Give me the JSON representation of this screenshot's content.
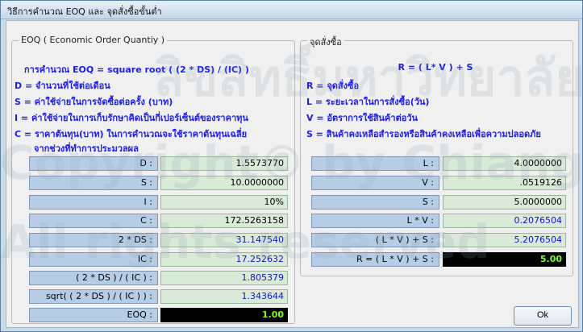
{
  "window": {
    "title": "วิธีการคำนวณ EOQ และ จุดสั่งซื้อขั้นต่ำ"
  },
  "eoq": {
    "group_title": "EOQ ( Economic Order Quantiy )",
    "formula": "การคำนวณ EOQ = square root ( (2 * DS) / (IC) )",
    "defs": [
      "D = จำนวนที่ใช้ต่อเดือน",
      "S = ค่าใช้จ่ายในการจัดซื้อต่อครั้ง (บาท)",
      "I = ค่าใช้จ่ายในการเก็บรักษาคิดเป็นกี่เปอร์เซ็นต์ของราคาทุน",
      "C = ราคาต้นทุน(บาท) ในการคำนวณจะใช้ราคาต้นทุนเฉลี่ย",
      "จากช่วงที่ทำการประมวลผล"
    ],
    "rows": [
      {
        "label": "D :",
        "value": "1.5573770"
      },
      {
        "label": "S :",
        "value": "10.0000000"
      },
      {
        "label": "I :",
        "value": "10%"
      },
      {
        "label": "C :",
        "value": "172.5263158"
      },
      {
        "label": "2 * DS :",
        "value": "31.147540"
      },
      {
        "label": "IC :",
        "value": "17.252632"
      },
      {
        "label": "( 2 * DS ) / ( IC ) :",
        "value": "1.805379"
      },
      {
        "label": "sqrt( ( 2 * DS ) / ( IC ) ) :",
        "value": "1.343644"
      },
      {
        "label": "EOQ :",
        "value": "1.00"
      }
    ]
  },
  "rop": {
    "group_title": "จุดสั่งซื้อ",
    "formula": "R = ( L* V ) + S",
    "defs": [
      "R = จุดสั่งซื้อ",
      "L = ระยะเวลาในการสั่งซื้อ(วัน)",
      "V = อัตราการใช้สินค้าต่อวัน",
      "S = สินค้าคงเหลือสำรองหรือสินค้าคงเหลือเพื่อความปลอดภัย"
    ],
    "rows": [
      {
        "label": "L :",
        "value": "4.0000000"
      },
      {
        "label": "V :",
        "value": ".0519126"
      },
      {
        "label": "S :",
        "value": "5.0000000"
      },
      {
        "label": "L * V :",
        "value": "0.2076504"
      },
      {
        "label": "( L * V ) + S :",
        "value": "5.2076504"
      },
      {
        "label": "R = ( L * V ) + S :",
        "value": "5.00"
      }
    ]
  },
  "buttons": {
    "ok": "Ok"
  },
  "watermark": {
    "lines": [
      "ลิขสิทธิ์มหาวิทยาลัยเชียงใหม่",
      "Copyright© by Chiang Mai University",
      "All rights reserved"
    ]
  }
}
